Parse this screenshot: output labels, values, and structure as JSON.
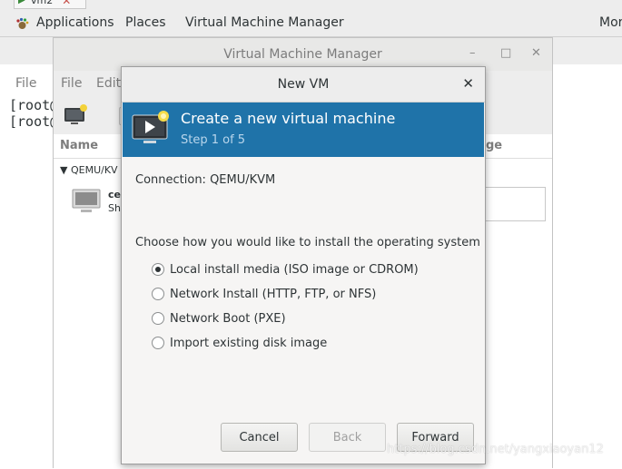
{
  "tab": {
    "label": "vm2",
    "close_glyph": "✕"
  },
  "panel": {
    "applications": "Applications",
    "places": "Places",
    "vmm": "Virtual Machine Manager",
    "more": "Mor"
  },
  "terminal": {
    "menu_file": "File",
    "lines": [
      "[root@",
      "[root@"
    ]
  },
  "vmm_window": {
    "title": "Virtual Machine Manager",
    "minimize": "–",
    "maximize": "□",
    "close": "✕",
    "menu_file": "File",
    "menu_edit": "Edit",
    "col_name": "Name",
    "col_usage": "ge",
    "connection_row": "QEMU/KV",
    "vm_name": "cer",
    "vm_status": "Shu"
  },
  "dialog": {
    "title": "New VM",
    "close": "✕",
    "header_title": "Create a new virtual machine",
    "header_step": "Step 1 of 5",
    "connection_label": "Connection:  QEMU/KVM",
    "choose_label": "Choose how you would like to install the operating system",
    "options": [
      {
        "label": "Local install media (ISO image or CDROM)",
        "checked": true
      },
      {
        "label": "Network Install (HTTP, FTP, or NFS)",
        "checked": false
      },
      {
        "label": "Network Boot (PXE)",
        "checked": false
      },
      {
        "label": "Import existing disk image",
        "checked": false
      }
    ],
    "buttons": {
      "cancel": "Cancel",
      "back": "Back",
      "forward": "Forward"
    }
  },
  "watermark": "https://blog.csdn.net/yangxiaoyan12",
  "colors": {
    "header_bg": "#1f73a9",
    "panel_bg": "#ededed",
    "dialog_bg": "#f6f5f4"
  }
}
